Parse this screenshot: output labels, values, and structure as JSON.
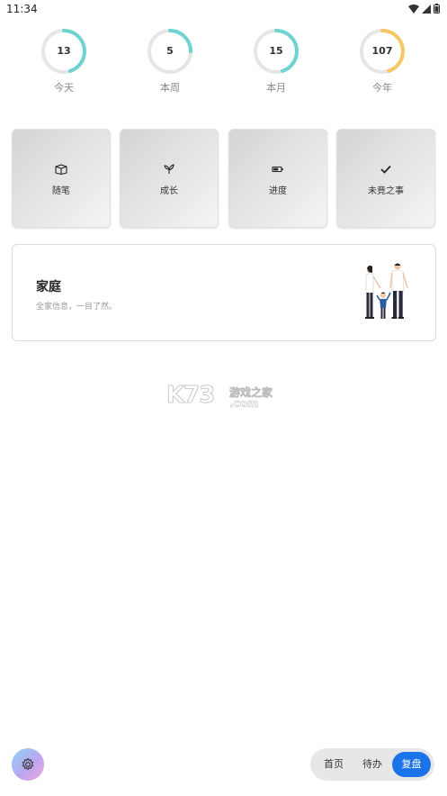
{
  "status_bar": {
    "time": "11:34"
  },
  "stats": [
    {
      "value": "13",
      "label": "今天",
      "progress": 0.45,
      "color": "#6fd3cf"
    },
    {
      "value": "5",
      "label": "本周",
      "progress": 0.25,
      "color": "#6fd3cf"
    },
    {
      "value": "15",
      "label": "本月",
      "progress": 0.45,
      "color": "#6fd3cf"
    },
    {
      "value": "107",
      "label": "今年",
      "progress": 0.45,
      "color": "#f6c867"
    }
  ],
  "cards": [
    {
      "label": "随笔",
      "icon": "box-icon"
    },
    {
      "label": "成长",
      "icon": "leaf-icon"
    },
    {
      "label": "进度",
      "icon": "battery-icon"
    },
    {
      "label": "未竟之事",
      "icon": "check-icon"
    }
  ],
  "family": {
    "title": "家庭",
    "subtitle": "全家信息，一目了然。"
  },
  "watermark": {
    "main": "K73",
    "line1": "游戏之家",
    "line2": ".com"
  },
  "bottom_nav": {
    "items": [
      {
        "label": "首页",
        "active": false
      },
      {
        "label": "待办",
        "active": false
      },
      {
        "label": "复盘",
        "active": true
      }
    ]
  },
  "colors": {
    "ring_track": "#e6e6e6",
    "accent": "#1a73e8"
  }
}
